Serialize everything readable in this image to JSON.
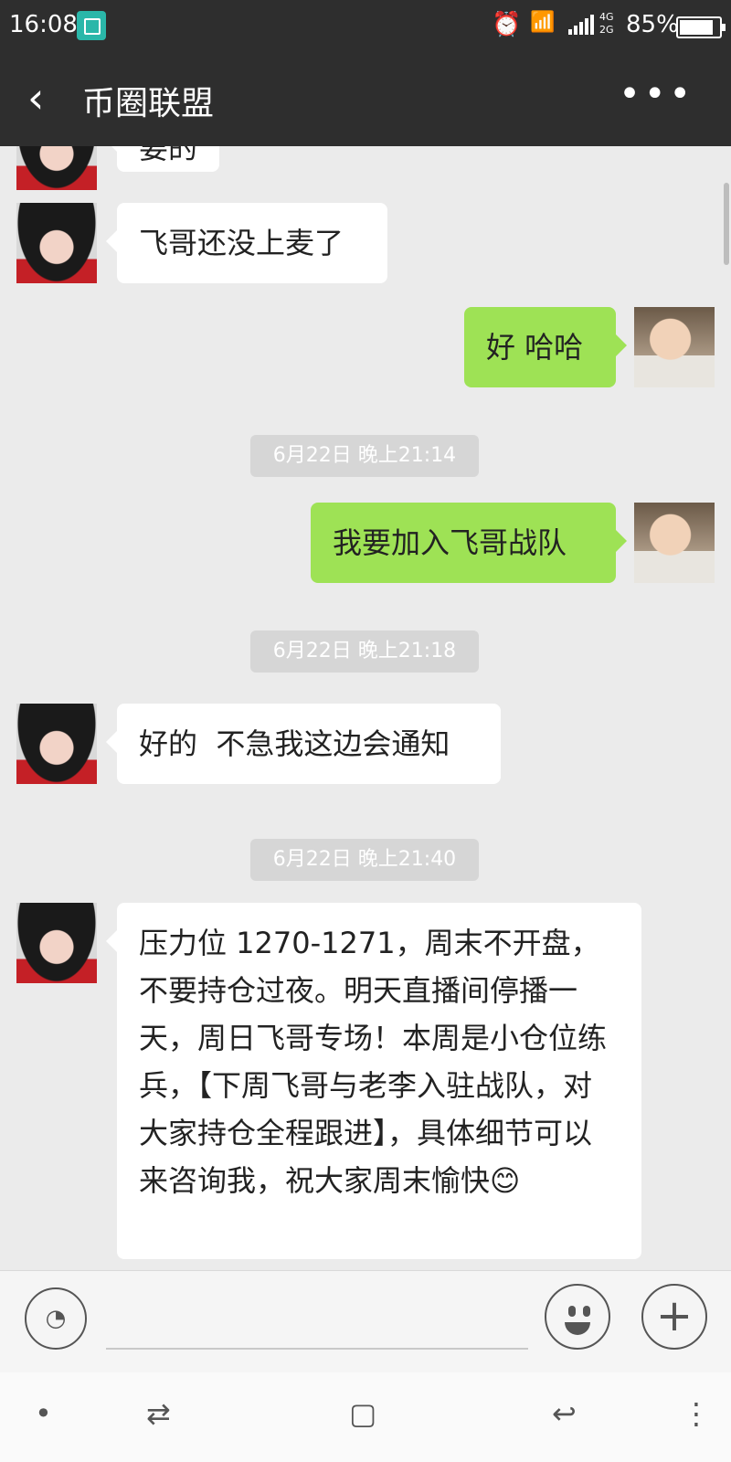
{
  "status": {
    "time": "16:08",
    "network": "4G\n2G",
    "battery_pct": "85%",
    "battery_level": 0.85,
    "icons": [
      "screenshot-icon",
      "alarm-icon",
      "wifi-icon",
      "signal-icon",
      "battery-icon"
    ]
  },
  "header": {
    "title": "币圈联盟",
    "back_icon": "chevron-left-icon",
    "more_icon": "more-dots-icon"
  },
  "messages": [
    {
      "side": "left",
      "text": "要的"
    },
    {
      "side": "left",
      "text": "飞哥还没上麦了"
    },
    {
      "side": "right",
      "text": "好 哈哈"
    },
    {
      "type": "time",
      "text": "6月22日 晚上21:14"
    },
    {
      "side": "right",
      "text": "我要加入飞哥战队"
    },
    {
      "type": "time",
      "text": "6月22日 晚上21:18"
    },
    {
      "side": "left",
      "text": "好的  不急我这边会通知"
    },
    {
      "type": "time",
      "text": "6月22日 晚上21:40"
    },
    {
      "side": "left",
      "text": "压力位 1270-1271，周末不开盘，不要持仓过夜。明天直播间停播一天，周日飞哥专场！本周是小仓位练兵，【下周飞哥与老李入驻战队，对大家持仓全程跟进】，具体细节可以来咨询我，祝大家周末愉快😊"
    }
  ],
  "input": {
    "voice_icon": "voice-icon",
    "emoji_icon": "emoji-icon",
    "plus_icon": "plus-icon"
  },
  "nav": {
    "items": [
      "•",
      "⇄",
      "▢",
      "↩",
      "⋮"
    ]
  },
  "colors": {
    "bar_bg": "#2e2e2e",
    "chat_bg": "#ebebeb",
    "my_bubble": "#9ee255",
    "other_bubble": "#ffffff"
  }
}
